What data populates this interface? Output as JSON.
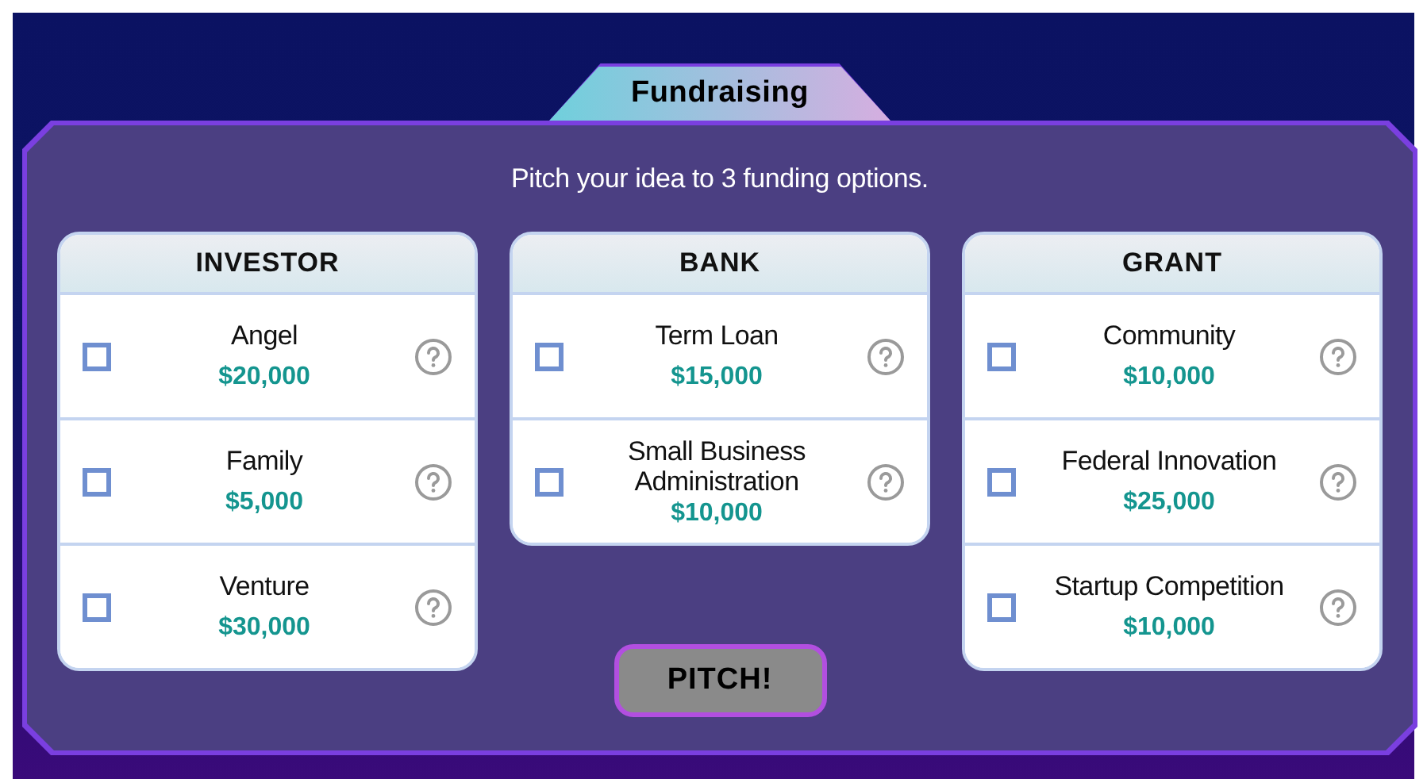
{
  "tab": {
    "title": "Fundraising"
  },
  "instruction": "Pitch your idea to 3 funding options.",
  "categories": [
    {
      "title": "INVESTOR",
      "options": [
        {
          "name": "Angel",
          "amount": "$20,000",
          "checked": false
        },
        {
          "name": "Family",
          "amount": "$5,000",
          "checked": false
        },
        {
          "name": "Venture",
          "amount": "$30,000",
          "checked": false
        }
      ]
    },
    {
      "title": "BANK",
      "options": [
        {
          "name": "Term Loan",
          "amount": "$15,000",
          "checked": false
        },
        {
          "name": "Small Business Administration",
          "amount": "$10,000",
          "checked": false
        }
      ]
    },
    {
      "title": "GRANT",
      "options": [
        {
          "name": "Community",
          "amount": "$10,000",
          "checked": false
        },
        {
          "name": "Federal Innovation",
          "amount": "$25,000",
          "checked": false
        },
        {
          "name": "Startup Competition",
          "amount": "$10,000",
          "checked": false
        }
      ]
    }
  ],
  "pitch_button": {
    "label": "PITCH!",
    "disabled": true
  }
}
